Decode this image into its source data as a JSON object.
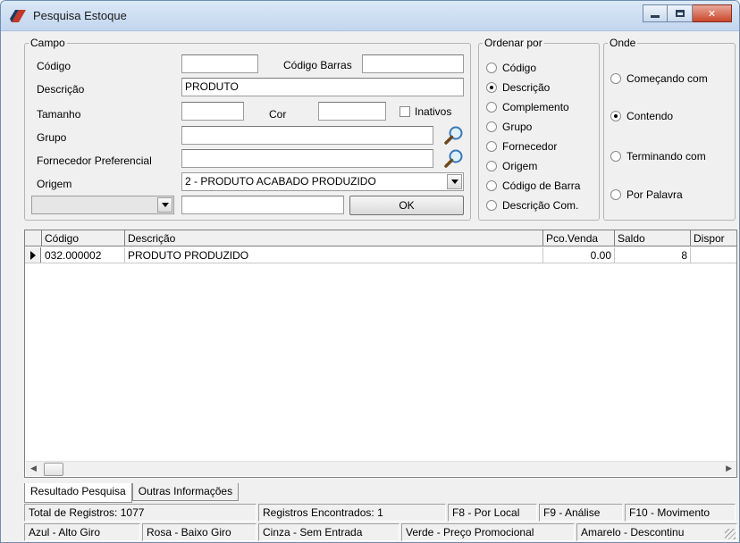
{
  "window": {
    "title": "Pesquisa Estoque"
  },
  "campo": {
    "legend": "Campo",
    "codigo_label": "Código",
    "codigo_value": "",
    "codigo_barras_label": "Código Barras",
    "codigo_barras_value": "",
    "descricao_label": "Descrição",
    "descricao_value": "PRODUTO",
    "tamanho_label": "Tamanho",
    "tamanho_value": "",
    "cor_label": "Cor",
    "cor_value": "",
    "inativos_label": "Inativos",
    "grupo_label": "Grupo",
    "grupo_value": "",
    "fornecedor_label": "Fornecedor Preferencial",
    "fornecedor_value": "",
    "origem_label": "Origem",
    "origem_value": "2 - PRODUTO ACABADO PRODUZIDO",
    "extra_combo_value": "",
    "extra_input_value": "",
    "ok_label": "OK"
  },
  "ordenar": {
    "legend": "Ordenar por",
    "options": [
      "Código",
      "Descrição",
      "Complemento",
      "Grupo",
      "Fornecedor",
      "Origem",
      "Código de Barra",
      "Descrição Com."
    ],
    "selected": "Descrição"
  },
  "onde": {
    "legend": "Onde",
    "options": [
      "Começando com",
      "Contendo",
      "Terminando com",
      "Por Palavra"
    ],
    "selected": "Contendo"
  },
  "grid": {
    "columns": [
      "Código",
      "Descrição",
      "Pco.Venda",
      "Saldo",
      "Dispor"
    ],
    "rows": [
      [
        "032.000002",
        "PRODUTO PRODUZIDO",
        "0.00",
        "8",
        ""
      ]
    ]
  },
  "tabs": [
    "Resultado Pesquisa",
    "Outras Informações"
  ],
  "status1": [
    "Total de Registros: 1077",
    "Registros Encontrados: 1",
    "F8 - Por Local",
    "F9 - Análise",
    "F10 - Movimento"
  ],
  "status2": [
    "Azul - Alto Giro",
    "Rosa - Baixo Giro",
    "Cinza - Sem Entrada",
    "Verde - Preço Promocional",
    "Amarelo - Descontinu"
  ],
  "icons": {
    "app": "app-logo-icon",
    "search": "magnifier-icon"
  },
  "colors": {
    "titlebar": "#c2d6ee",
    "close_button": "#c9462c"
  }
}
